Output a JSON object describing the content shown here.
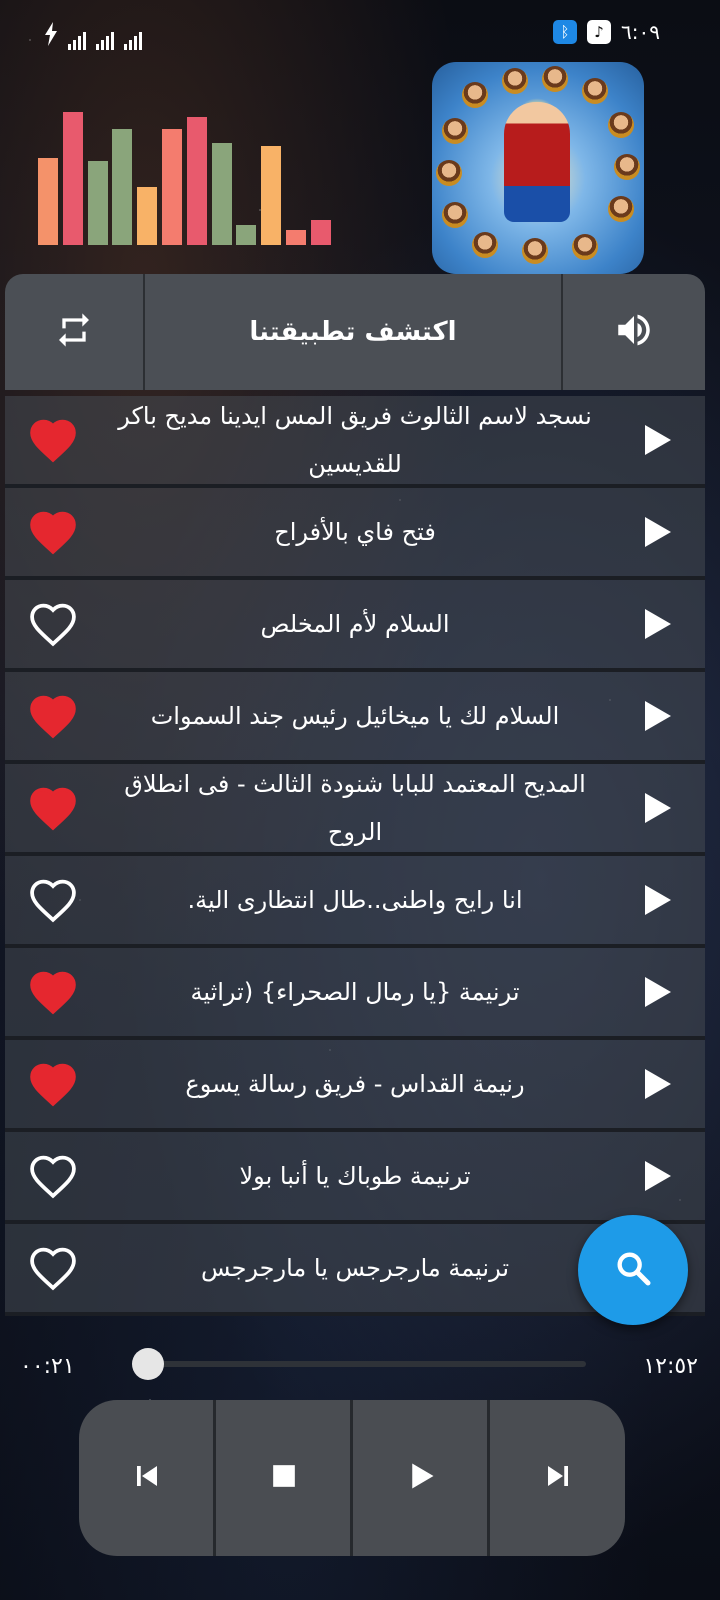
{
  "status_bar": {
    "time": "٦:٠٩",
    "icons": [
      "charging-bolt-icon",
      "signal-icon",
      "signal-icon",
      "signal-icon",
      "bluetooth-icon",
      "music-icon"
    ]
  },
  "equalizer": {
    "levels": [
      0.6,
      0.92,
      0.58,
      0.8,
      0.4,
      0.8,
      0.88,
      0.7,
      0.14,
      0.68,
      0.1,
      0.17
    ],
    "colors": [
      "#f4926a",
      "#e85a6d",
      "#8aa57b",
      "#8aa57b",
      "#f8b267",
      "#f47c6e",
      "#e85a6d",
      "#8aa57b",
      "#8aa57b",
      "#f8b267",
      "#f47c6e",
      "#e85a6d"
    ]
  },
  "header": {
    "title": "اكتشف تطبيقتنا",
    "left_icon": "repeat-icon",
    "right_icon": "volume-icon"
  },
  "songs": [
    {
      "title": "نسجد لاسم الثالوث فريق المس ايدينا مديح باكر للقديسين",
      "favorite": true
    },
    {
      "title": "فتح فاي بالأفراح",
      "favorite": true
    },
    {
      "title": "السلام لأم المخلص",
      "favorite": false
    },
    {
      "title": "السلام لك يا ميخائيل رئيس جند السموات",
      "favorite": true
    },
    {
      "title": "المديح المعتمد للبابا شنودة الثالث - فى انطلاق الروح",
      "favorite": true
    },
    {
      "title": "انا رايح واطنى..طال انتظارى الية.",
      "favorite": false
    },
    {
      "title": "ترنيمة {يا رمال الصحراء} (تراثية",
      "favorite": true
    },
    {
      "title": "رنيمة القداس - فريق رسالة يسوع",
      "favorite": true
    },
    {
      "title": "ترنيمة طوباك يا أنبا بولا",
      "favorite": false
    },
    {
      "title": "ترنيمة مارجرجس يا مارجرجس",
      "favorite": false
    }
  ],
  "player": {
    "elapsed": "٠٠:٢١",
    "duration": "١٢:٥٢",
    "progress": 0.03,
    "buttons": [
      "previous-icon",
      "stop-icon",
      "play-icon",
      "next-icon"
    ]
  },
  "colors": {
    "heart_active": "#e5272f",
    "fab": "#1e9be8"
  }
}
